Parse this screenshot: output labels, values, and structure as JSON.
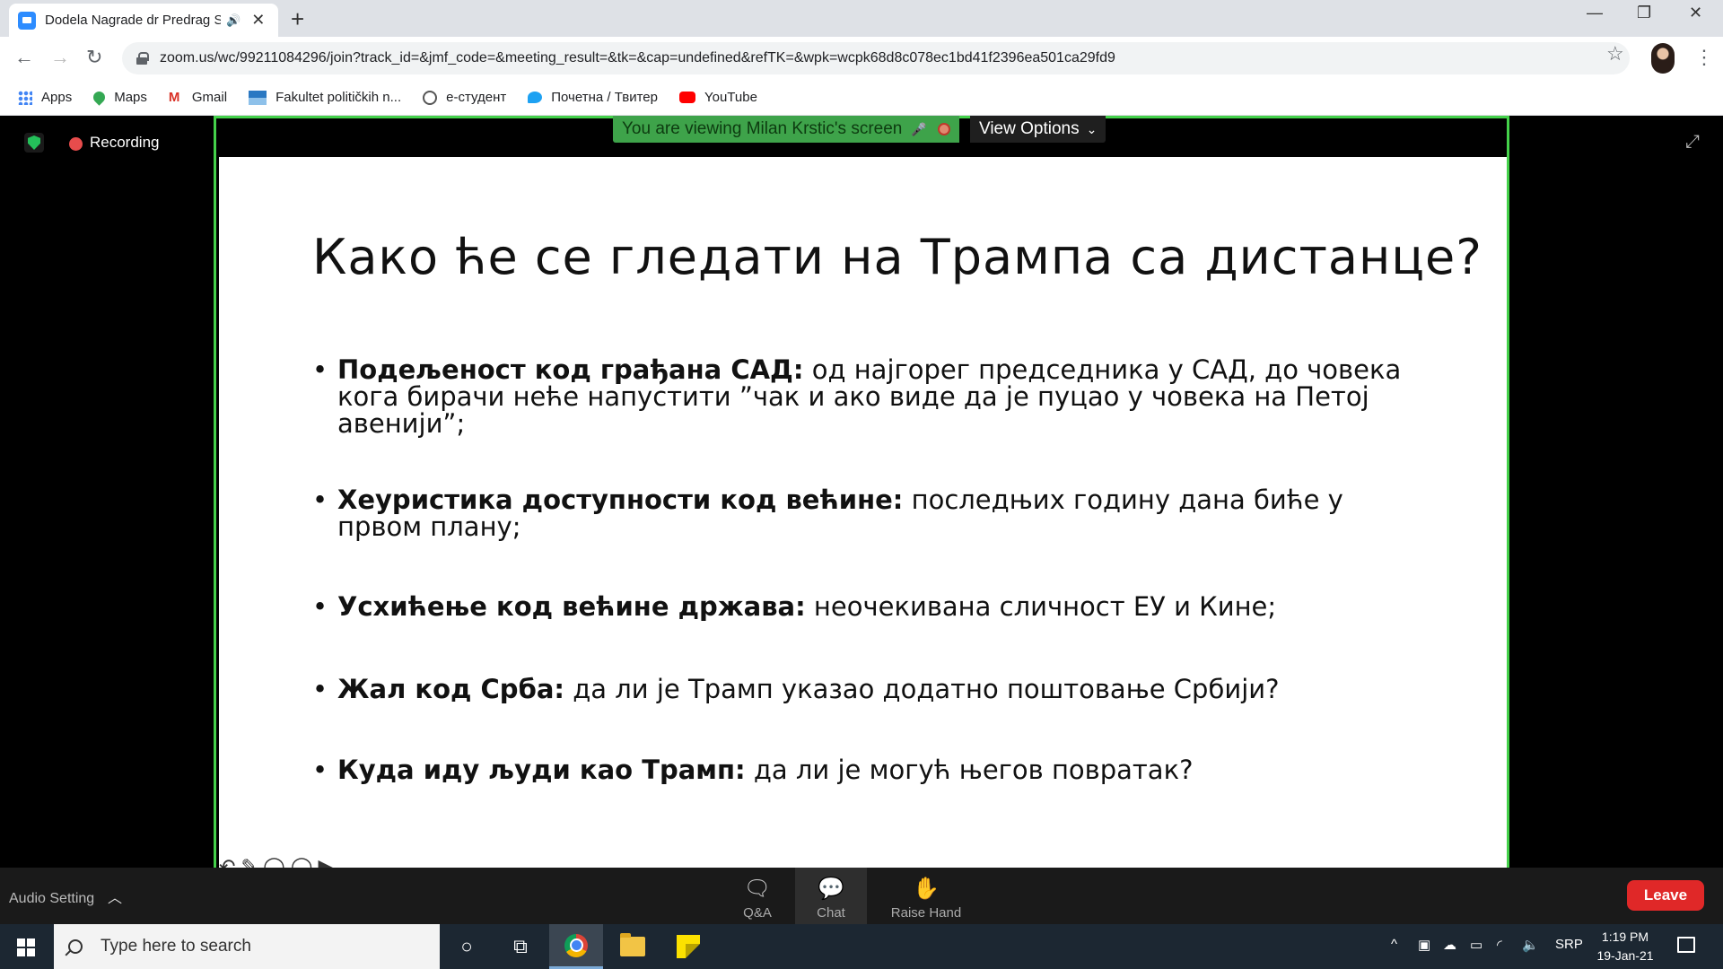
{
  "browser": {
    "tab_title": "Dodela Nagrade dr Predrag S",
    "tab_audio_icon": "speaker-icon",
    "tab_close": "✕",
    "new_tab": "+",
    "window_controls": [
      "—",
      "❐",
      "✕"
    ],
    "url": "zoom.us/wc/99211084296/join?track_id=&jmf_code=&meeting_result=&tk=&cap=undefined&refTK=&wpk=wcpk68d8c078ec1bd41f2396ea501ca29fd9",
    "bookmarks": [
      {
        "label": "Apps",
        "icon": "apps-grid-icon"
      },
      {
        "label": "Maps",
        "icon": "maps-pin-icon"
      },
      {
        "label": "Gmail",
        "icon": "gmail-icon"
      },
      {
        "label": "Fakultet političkih n...",
        "icon": "faculty-icon"
      },
      {
        "label": "е-студент",
        "icon": "globe-icon"
      },
      {
        "label": "Почетна / Твитер",
        "icon": "twitter-icon"
      },
      {
        "label": "YouTube",
        "icon": "youtube-icon"
      }
    ]
  },
  "zoom": {
    "recording_label": "Recording",
    "viewing_banner": "You are viewing Milan Krstic's screen",
    "view_options_label": "View Options",
    "slide": {
      "title": "Како ће се гледати на Трампа са дистанце?",
      "bullets": [
        {
          "bold": "Подељеност код грађана САД:",
          "text": " од најгорег председника у САД, до човека кога бирачи неће напустити ”чак и ако виде да је пуцао у човека на Петој авенији”;"
        },
        {
          "bold": "Хеуристика доступности код већине:",
          "text": " последњих годину дана биће у првом плану;"
        },
        {
          "bold": "Усхићење код већине држава:",
          "text": " неочекивана сличност ЕУ и Кине;"
        },
        {
          "bold": "Жал код Срба:",
          "text": " да ли је Трамп указао додатно поштовање Србији?"
        },
        {
          "bold": "Куда иду људи као Трамп:",
          "text": " да ли је могућ његов повратак?"
        }
      ]
    },
    "toolbar": {
      "audio_setting": "Audio Setting",
      "qa_label": "Q&A",
      "chat_label": "Chat",
      "raise_hand_label": "Raise Hand",
      "leave_label": "Leave"
    },
    "colors": {
      "share_border": "#44d14a",
      "banner_green": "#3ea34a",
      "leave_red": "#e02828"
    }
  },
  "taskbar": {
    "search_placeholder": "Type here to search",
    "language": "SRP",
    "time": "1:19 PM",
    "date": "19-Jan-21"
  }
}
